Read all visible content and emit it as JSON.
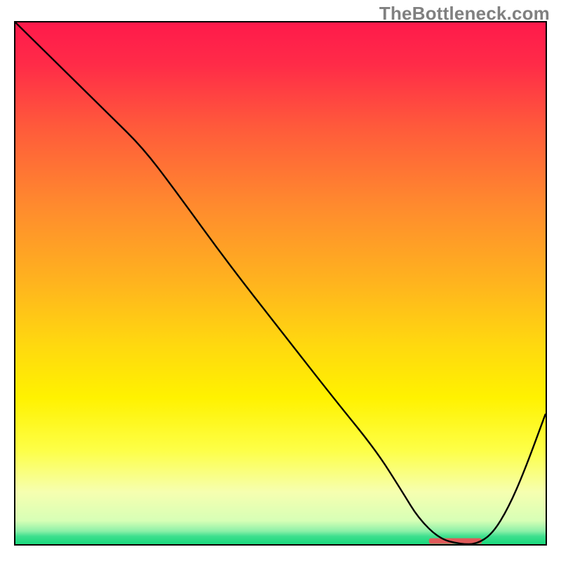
{
  "watermark": "TheBottleneck.com",
  "colors": {
    "border": "#000000",
    "line": "#000000",
    "watermark": "#808080",
    "gradient_stops": [
      {
        "offset": 0.0,
        "color": "#ff1a4b"
      },
      {
        "offset": 0.08,
        "color": "#ff2b48"
      },
      {
        "offset": 0.2,
        "color": "#ff5a3b"
      },
      {
        "offset": 0.35,
        "color": "#ff8a2e"
      },
      {
        "offset": 0.5,
        "color": "#ffb41e"
      },
      {
        "offset": 0.62,
        "color": "#ffd90f"
      },
      {
        "offset": 0.72,
        "color": "#fff200"
      },
      {
        "offset": 0.82,
        "color": "#fdff47"
      },
      {
        "offset": 0.9,
        "color": "#f6ffb0"
      },
      {
        "offset": 0.955,
        "color": "#d7ffb6"
      },
      {
        "offset": 0.975,
        "color": "#8cf0a8"
      },
      {
        "offset": 0.985,
        "color": "#3ddf8e"
      },
      {
        "offset": 1.0,
        "color": "#19d87c"
      }
    ],
    "marker": "#e05a5a"
  },
  "chart_data": {
    "type": "line",
    "title": "",
    "xlabel": "",
    "ylabel": "",
    "xlim": [
      0,
      100
    ],
    "ylim": [
      0,
      100
    ],
    "grid": false,
    "legend": false,
    "series": [
      {
        "name": "curve",
        "x": [
          0,
          6,
          18,
          24,
          30,
          40,
          50,
          60,
          68,
          73,
          76,
          80,
          84,
          87,
          90,
          93,
          96,
          100
        ],
        "y": [
          100,
          94,
          82,
          76,
          68,
          54,
          41,
          28,
          18,
          10,
          5,
          1,
          0,
          0,
          2,
          7,
          14,
          25
        ]
      }
    ],
    "highlight_band": {
      "x_start": 78,
      "x_end": 88,
      "y": 0.6
    },
    "annotations": []
  }
}
